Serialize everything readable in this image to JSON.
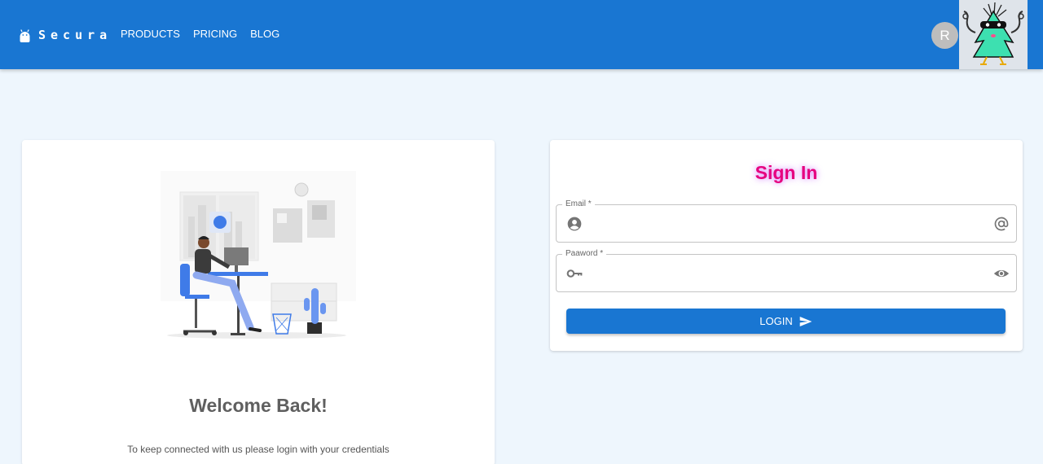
{
  "appbar": {
    "brand_name": "Secura",
    "nav": [
      "PRODUCTS",
      "PRICING",
      "BLOG"
    ],
    "avatar_letter": "R",
    "brand_icon": "android-icon",
    "mascot_icon": "bandit-tree-mascot-icon",
    "color": "#1976d2"
  },
  "welcome": {
    "title": "Welcome Back!",
    "subtitle": "To keep connected with us please login with your credentials",
    "illustration": "person-working-at-desk-illustration"
  },
  "signin": {
    "title": "Sign In",
    "title_color": "#e6007e",
    "email": {
      "label": "Email *",
      "value": "",
      "start_icon": "account-circle-icon",
      "end_icon": "at-sign-icon"
    },
    "password": {
      "label": "Paaword *",
      "value": "",
      "start_icon": "key-icon",
      "end_icon": "eye-icon"
    },
    "login_label": "LOGIN",
    "login_icon": "send-icon"
  }
}
